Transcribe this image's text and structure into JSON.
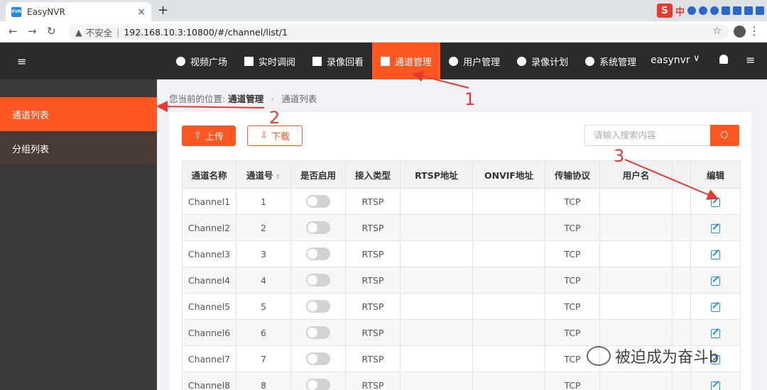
{
  "browser": {
    "tab_title": "EasyNVR",
    "favicon_text": "EVR",
    "new_tab": "+",
    "close": "×",
    "insecure_label": "不安全",
    "url": "192.168.10.3:10800/#/channel/list/1",
    "ext_logo": "S",
    "ext_lang": "中"
  },
  "header": {
    "menu_icon": "≡",
    "menu": [
      {
        "label": "视频广场",
        "icon": "play-circle-icon"
      },
      {
        "label": "实时调阅",
        "icon": "video-icon"
      },
      {
        "label": "录像回看",
        "icon": "playback-icon"
      },
      {
        "label": "通道管理",
        "icon": "channel-icon"
      },
      {
        "label": "用户管理",
        "icon": "user-icon"
      },
      {
        "label": "录像计划",
        "icon": "film-reel-icon"
      },
      {
        "label": "系统管理",
        "icon": "gear-icon"
      }
    ],
    "active_index": 3,
    "username": "easynvr"
  },
  "sidebar": {
    "items": [
      {
        "label": "通道列表",
        "active": true
      },
      {
        "label": "分组列表",
        "active": false
      }
    ]
  },
  "breadcrumb": {
    "prefix": "您当前的位置:",
    "parent": "通道管理",
    "current": "通道列表"
  },
  "toolbar": {
    "upload_label": "上传",
    "download_label": "下载",
    "search_placeholder": "请输入搜索内容"
  },
  "table": {
    "columns": [
      "通道名称",
      "通道号",
      "是否启用",
      "接入类型",
      "RTSP地址",
      "ONVIF地址",
      "传输协议",
      "用户名",
      "",
      "编辑"
    ],
    "rows": [
      {
        "name": "Channel1",
        "no": "1",
        "type": "RTSP",
        "proto": "TCP"
      },
      {
        "name": "Channel2",
        "no": "2",
        "type": "RTSP",
        "proto": "TCP"
      },
      {
        "name": "Channel3",
        "no": "3",
        "type": "RTSP",
        "proto": "TCP"
      },
      {
        "name": "Channel4",
        "no": "4",
        "type": "RTSP",
        "proto": "TCP"
      },
      {
        "name": "Channel5",
        "no": "5",
        "type": "RTSP",
        "proto": "TCP"
      },
      {
        "name": "Channel6",
        "no": "6",
        "type": "RTSP",
        "proto": "TCP"
      },
      {
        "name": "Channel7",
        "no": "7",
        "type": "RTSP",
        "proto": "TCP"
      },
      {
        "name": "Channel8",
        "no": "8",
        "type": "RTSP",
        "proto": "TCP"
      }
    ]
  },
  "annotations": {
    "n1": "1",
    "n2": "2",
    "n3": "3",
    "color": "#e53935"
  },
  "watermark": "被迫成为奋斗b",
  "colors": {
    "accent": "#ff5722",
    "header_bg": "#2b2b2b",
    "sidebar_bg": "#3a3a3a",
    "edit_icon": "#1e90ff"
  }
}
